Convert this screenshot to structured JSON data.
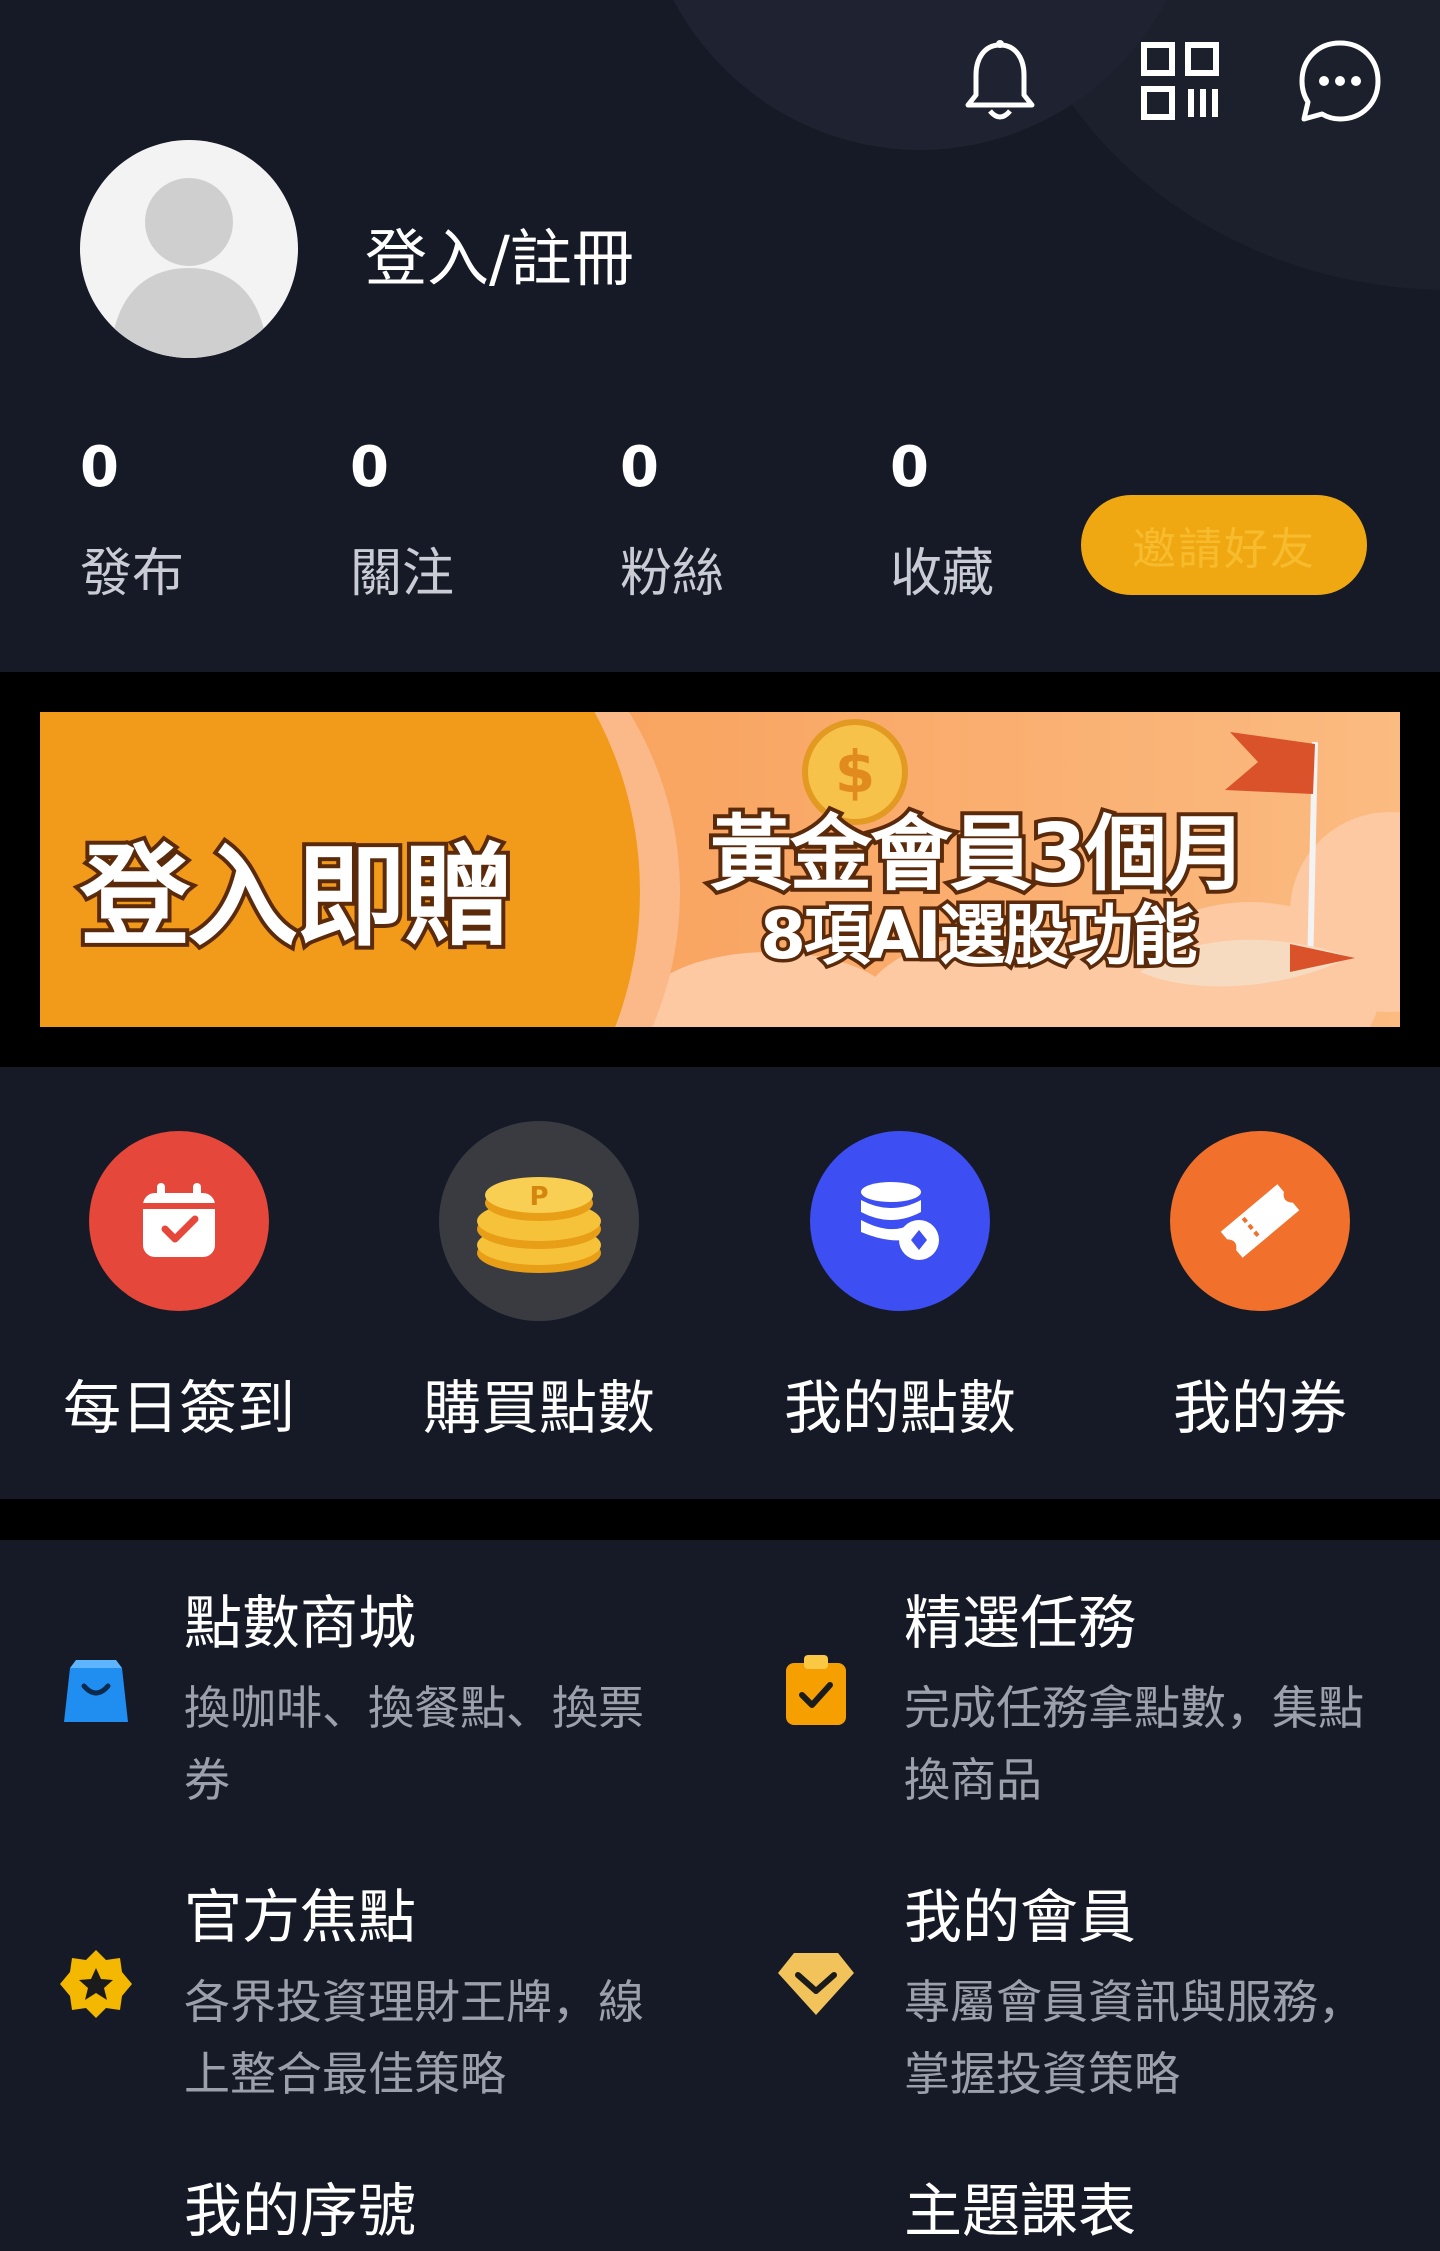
{
  "header": {
    "login_label": "登入/註冊",
    "stats": [
      {
        "value": "0",
        "label": "發布"
      },
      {
        "value": "0",
        "label": "關注"
      },
      {
        "value": "0",
        "label": "粉絲"
      },
      {
        "value": "0",
        "label": "收藏"
      }
    ],
    "invite_label": "邀請好友",
    "icons": [
      "bell-icon",
      "qr-code-icon",
      "chat-bubble-icon"
    ]
  },
  "banner": {
    "left_text": "登入即贈",
    "headline": "黃金會員3個月",
    "subline": "8項AI選股功能"
  },
  "quick_actions": [
    {
      "label": "每日簽到",
      "icon": "calendar-check-icon",
      "color": "#e5473b"
    },
    {
      "label": "購買點數",
      "icon": "gold-coins-icon",
      "color": "#3a3b40"
    },
    {
      "label": "我的點數",
      "icon": "database-icon",
      "color": "#3d4ef2"
    },
    {
      "label": "我的券",
      "icon": "ticket-icon",
      "color": "#f0702c"
    }
  ],
  "menu": [
    {
      "title": "點數商城",
      "desc": "換咖啡、換餐點、換票券",
      "icon": "shopping-bag-icon"
    },
    {
      "title": "精選任務",
      "desc": "完成任務拿點數，集點換商品",
      "icon": "clipboard-check-icon"
    },
    {
      "title": "官方焦點",
      "desc": "各界投資理財王牌，線上整合最佳策略",
      "icon": "star-badge-icon"
    },
    {
      "title": "我的會員",
      "desc": "專屬會員資訊與服務，掌握投資策略",
      "icon": "diamond-icon"
    },
    {
      "title": "我的序號",
      "desc": "",
      "icon": "serial-number-icon"
    },
    {
      "title": "主題課表",
      "desc": "",
      "icon": "book-icon"
    }
  ]
}
